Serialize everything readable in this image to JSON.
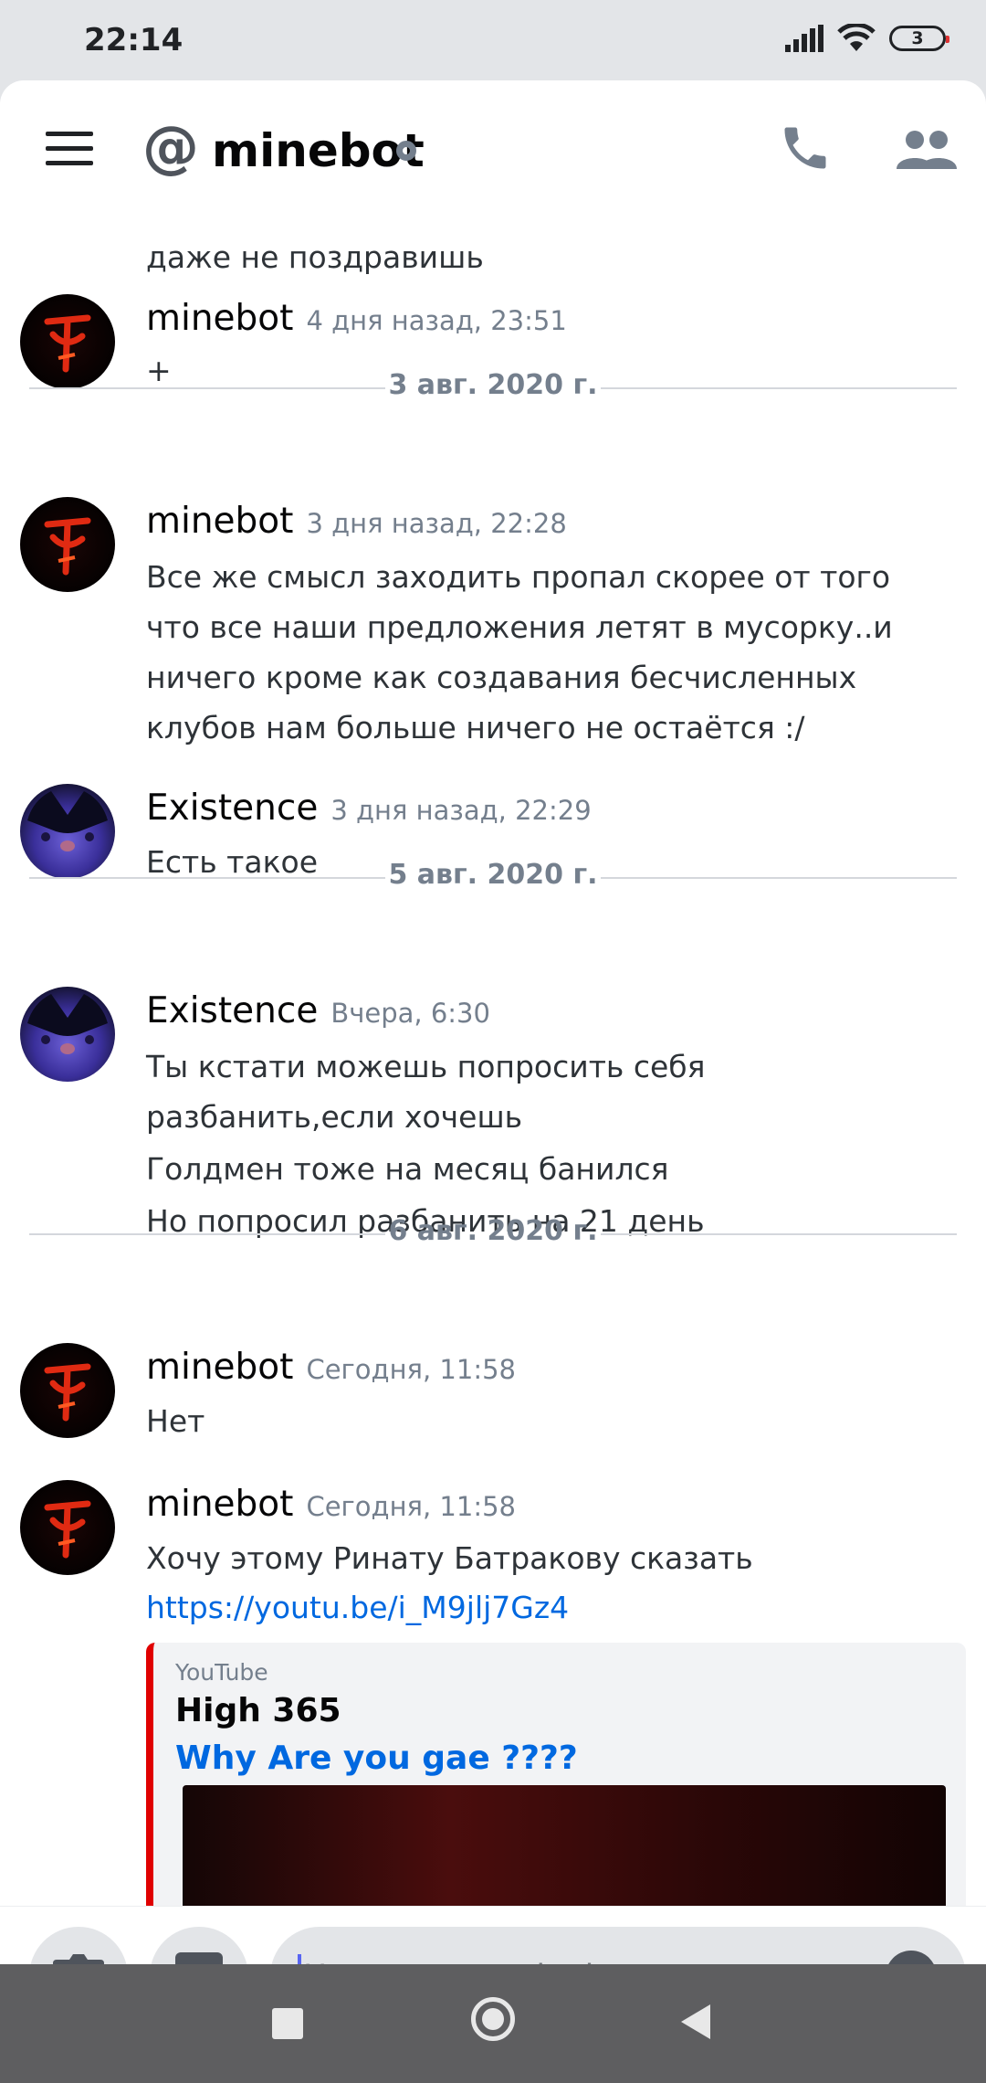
{
  "status_bar": {
    "time": "22:14",
    "battery": "3"
  },
  "header": {
    "at_symbol": "@",
    "title": "minebot"
  },
  "messages": [
    {
      "continuation_text": "даже не поздравишь"
    },
    {
      "author": "minebot",
      "time": "4 дня назад, 23:51",
      "lines": [
        "+"
      ]
    },
    {
      "divider": "3 авг. 2020 г."
    },
    {
      "author": "minebot",
      "time": "3 дня назад, 22:28",
      "lines": [
        "Все же смысл заходить пропал скорее от того что все наши предложения летят в мусорку..и ничего кроме как создавания бесчисленных клубов нам больше ничего не остаётся :/"
      ]
    },
    {
      "author": "Existence",
      "time": "3 дня назад, 22:29",
      "lines": [
        "Есть такое"
      ]
    },
    {
      "divider": "5 авг. 2020 г."
    },
    {
      "author": "Existence",
      "time": "Вчера, 6:30",
      "lines": [
        "Ты кстати можешь попросить себя разбанить,если хочешь",
        "Голдмен тоже на месяц банился",
        "Но попросил разбанить на 21 день"
      ]
    },
    {
      "divider": "6 авг. 2020 г."
    },
    {
      "author": "minebot",
      "time": "Сегодня, 11:58",
      "lines": [
        "Нет"
      ]
    },
    {
      "author": "minebot",
      "time": "Сегодня, 11:58",
      "lines": [
        "Хочу этому Ринату Батракову сказать"
      ],
      "link": "https://youtu.be/i_M9jlj7Gz4",
      "embed": {
        "provider": "YouTube",
        "author": "High 365",
        "title": "Why Are you gae ????"
      }
    }
  ],
  "input": {
    "placeholder": "Написать @minebot"
  },
  "colors": {
    "accent": "#5865f2",
    "link": "#0068e0",
    "embed_border": "#e00000"
  }
}
